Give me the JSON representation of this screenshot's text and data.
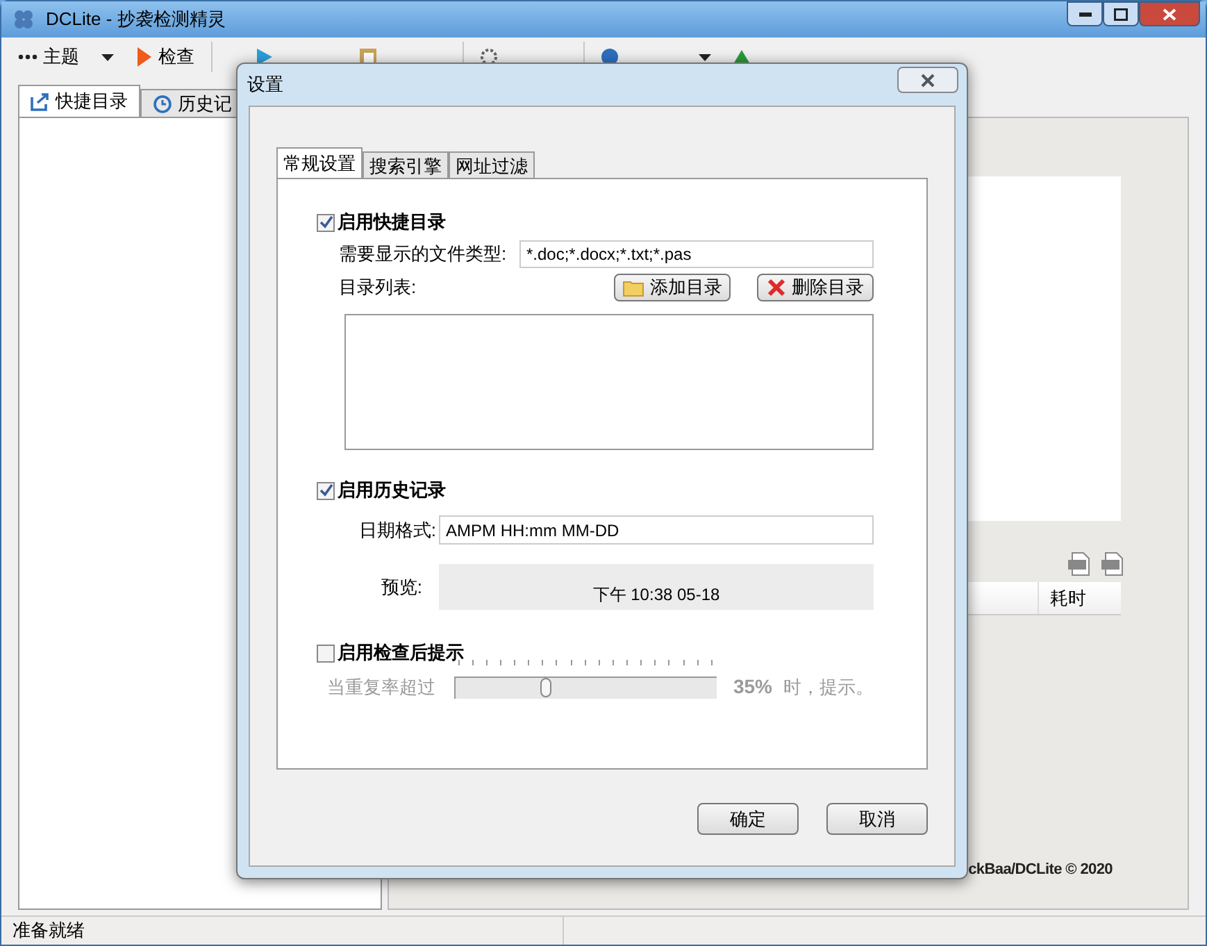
{
  "window": {
    "title": "DCLite - 抄袭检测精灵"
  },
  "toolbar": [
    {
      "label": "主题",
      "kind": "menu"
    },
    {
      "label": "检查",
      "kind": "button"
    },
    {
      "kind": "button"
    },
    {
      "kind": "button"
    },
    {
      "kind": "button"
    },
    {
      "kind": "menu"
    },
    {
      "kind": "button"
    }
  ],
  "left_panel": {
    "tabs": [
      {
        "label": "快捷目录",
        "selected": true
      },
      {
        "label": "历史记",
        "selected": false
      }
    ]
  },
  "main_panel": {
    "columns": [
      "耗时"
    ],
    "footer": "ckBaa/DCLite © 2020"
  },
  "status_bar": "准备就绪",
  "dialog": {
    "title": "设置",
    "tabs": [
      {
        "label": "常规设置",
        "selected": true
      },
      {
        "label": "搜索引擎",
        "selected": false
      },
      {
        "label": "网址过滤",
        "selected": false
      }
    ],
    "quick_dir": {
      "label": "启用快捷目录",
      "checked": true,
      "file_types_label": "需要显示的文件类型:",
      "file_types_value": "*.doc;*.docx;*.txt;*.pas",
      "dir_list_label": "目录列表:",
      "buttons": [
        "添加目录",
        "删除目录"
      ]
    },
    "history": {
      "label": "启用历史记录",
      "checked": true,
      "date_format_label": "日期格式:",
      "date_format_value": "AMPM HH:mm MM-DD",
      "preview_label": "预览:",
      "preview_value": "下午 10:38 05-18"
    },
    "alert": {
      "label": "启用检查后提示",
      "checked": false,
      "threshold_label": "当重复率超过",
      "level": 0.35,
      "reading": "35%",
      "suffix": "时，提示。"
    },
    "buttons": [
      "确定",
      "取消"
    ]
  }
}
